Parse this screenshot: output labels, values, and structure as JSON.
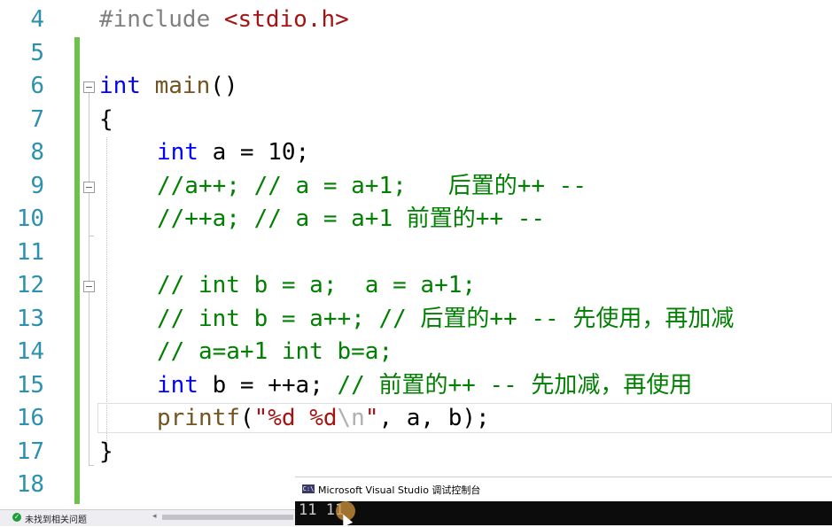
{
  "editor": {
    "line_numbers": [
      "4",
      "5",
      "6",
      "7",
      "8",
      "9",
      "10",
      "11",
      "12",
      "13",
      "14",
      "15",
      "16",
      "17",
      "18"
    ],
    "lines": {
      "l4": {
        "directive": "#include",
        "header": "<stdio.h>"
      },
      "l6": {
        "type": "int",
        "name": "main",
        "parens": "()"
      },
      "l7": {
        "text": "{"
      },
      "l8": {
        "type": "int",
        "rest": " a = 10;"
      },
      "l9": {
        "comment": "//a++; // a = a+1;   后置的++ --"
      },
      "l10": {
        "comment": "//++a; // a = a+1 前置的++ --"
      },
      "l12": {
        "comment": "// int b = a;  a = a+1;"
      },
      "l13": {
        "comment": "// int b = a++; // 后置的++ -- 先使用，再加减"
      },
      "l14": {
        "comment": "// a=a+1 int b=a;"
      },
      "l15": {
        "type": "int",
        "rest": " b = ++a; ",
        "comment": "// 前置的++ -- 先加减，再使用"
      },
      "l16": {
        "fn": "printf",
        "open": "(",
        "str1": "\"%d %d",
        "esc": "\\n",
        "str2": "\"",
        "args": ", a, b);"
      },
      "l17": {
        "text": "}"
      }
    }
  },
  "status": {
    "text": "未找到相关问题",
    "icon": "check-circle-icon",
    "scroll_left": "◂"
  },
  "console": {
    "title": "Microsoft Visual Studio 调试控制台",
    "icon": "console-app-icon",
    "icon_text": "C:\\",
    "output": "11 11"
  },
  "colors": {
    "keyword": "#0000ff",
    "comment": "#008000",
    "line_number": "#2b91af",
    "string": "#a31515",
    "change_bar": "#6cc24a"
  }
}
